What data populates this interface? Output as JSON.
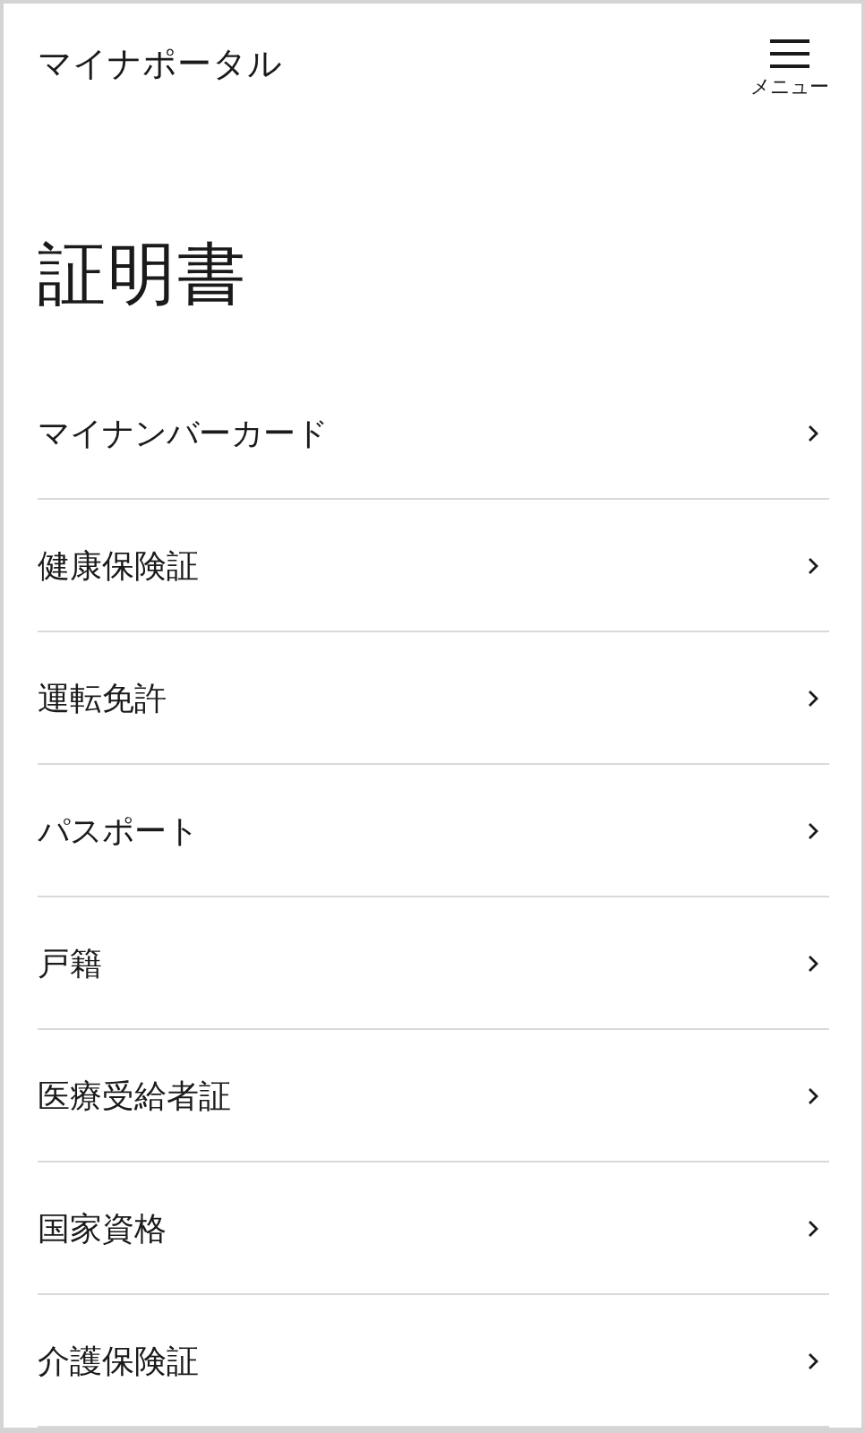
{
  "header": {
    "title": "マイナポータル",
    "menu_label": "メニュー"
  },
  "page_title": "証明書",
  "items": [
    {
      "label": "マイナンバーカード"
    },
    {
      "label": "健康保険証"
    },
    {
      "label": "運転免許"
    },
    {
      "label": "パスポート"
    },
    {
      "label": "戸籍"
    },
    {
      "label": "医療受給者証"
    },
    {
      "label": "国家資格"
    },
    {
      "label": "介護保険証"
    }
  ]
}
